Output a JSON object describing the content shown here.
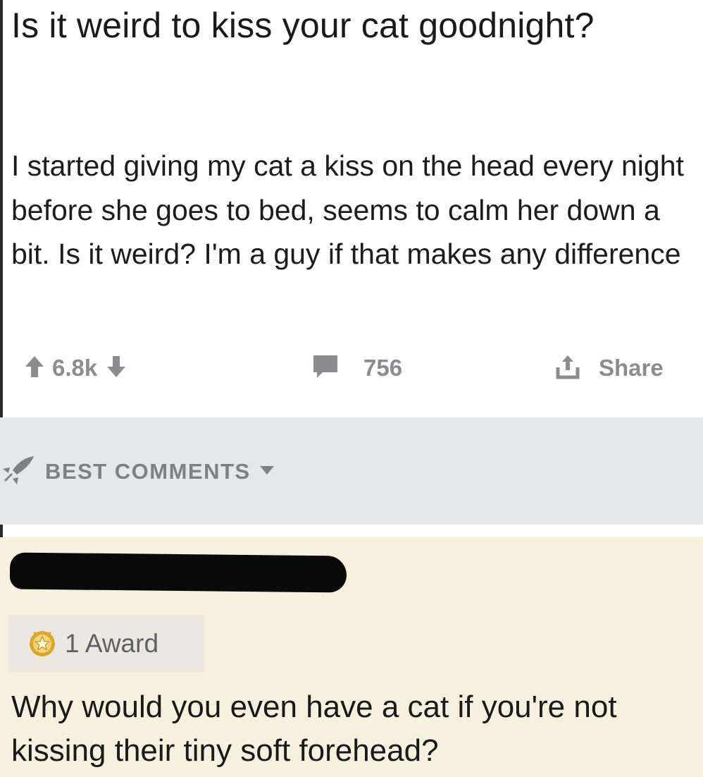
{
  "post": {
    "title": "Is it weird to kiss your cat goodnight?",
    "body": "I started giving my cat a kiss on the head every night before she goes to bed, seems to calm her down a bit. Is it weird? I'm a guy if that makes any difference"
  },
  "actions": {
    "upvote_icon": "arrow-up-icon",
    "score": "6.8k",
    "downvote_icon": "arrow-down-icon",
    "comments_icon": "comment-bubble-icon",
    "comment_count": "756",
    "share_icon": "share-icon",
    "share_label": "Share"
  },
  "sort": {
    "icon": "rocket-icon",
    "label": "BEST COMMENTS",
    "caret_icon": "caret-down-icon"
  },
  "comment": {
    "username_redacted": true,
    "award_icon": "award-badge-icon",
    "award_label": "1 Award",
    "text": "Why would you even have a cat if you're not kissing their tiny soft forehead?"
  },
  "colors": {
    "action_gray": "#8a8c8f",
    "band_gray": "#e5e8eb",
    "comment_bg": "#f6f0df",
    "award_gold": "#d9a72e"
  }
}
